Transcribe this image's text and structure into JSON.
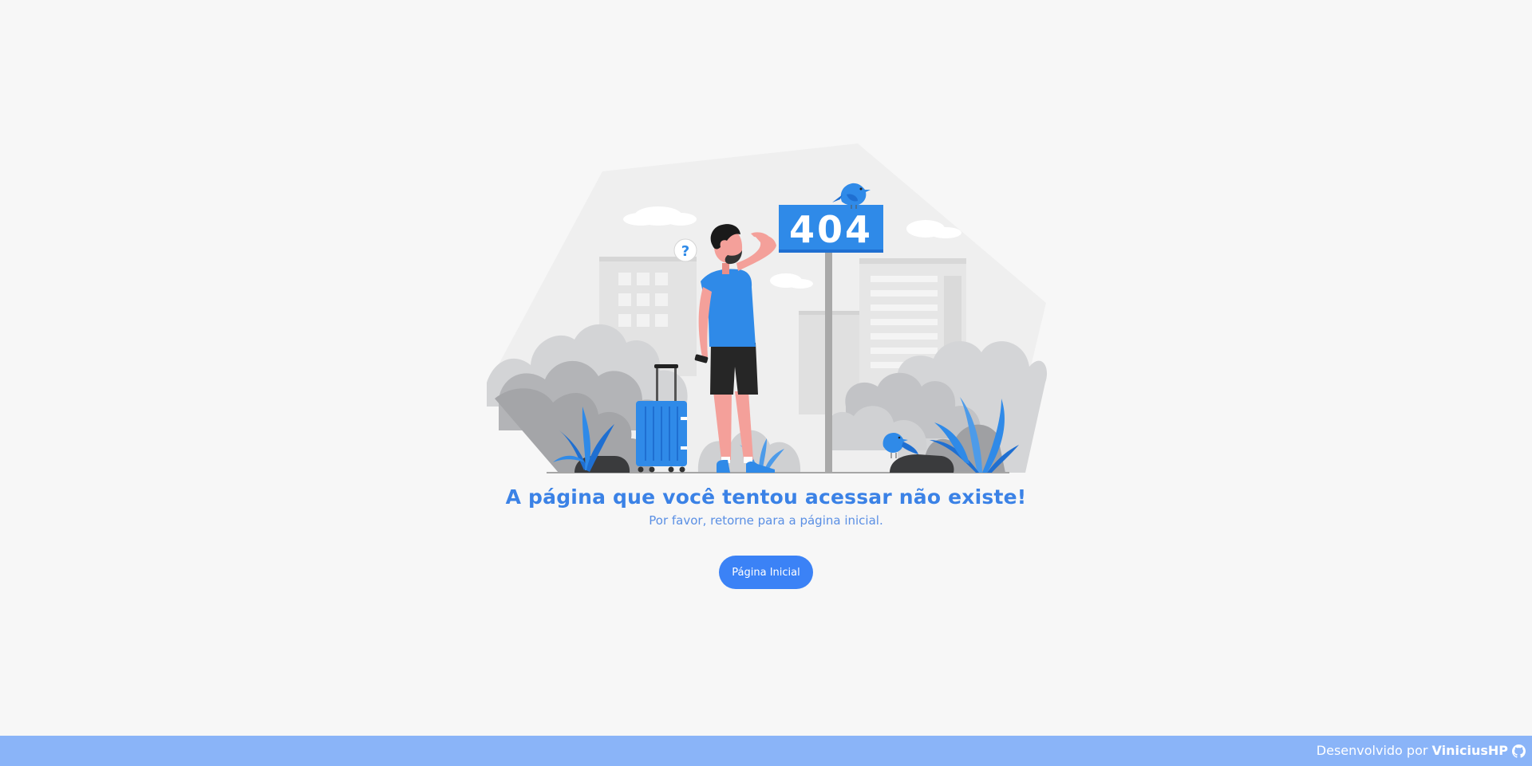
{
  "illustration": {
    "sign_text": "404",
    "question_mark": "?",
    "accent_color": "#2f8ae8"
  },
  "message": {
    "title": "A página que você tentou acessar não existe!",
    "subtitle": "Por favor, retorne para a página inicial."
  },
  "actions": {
    "home_label": "Página Inicial"
  },
  "footer": {
    "prefix": "Desenvolvido por",
    "author": "ViniciusHP",
    "icon": "github-icon",
    "background_color": "#8ab4f8"
  }
}
